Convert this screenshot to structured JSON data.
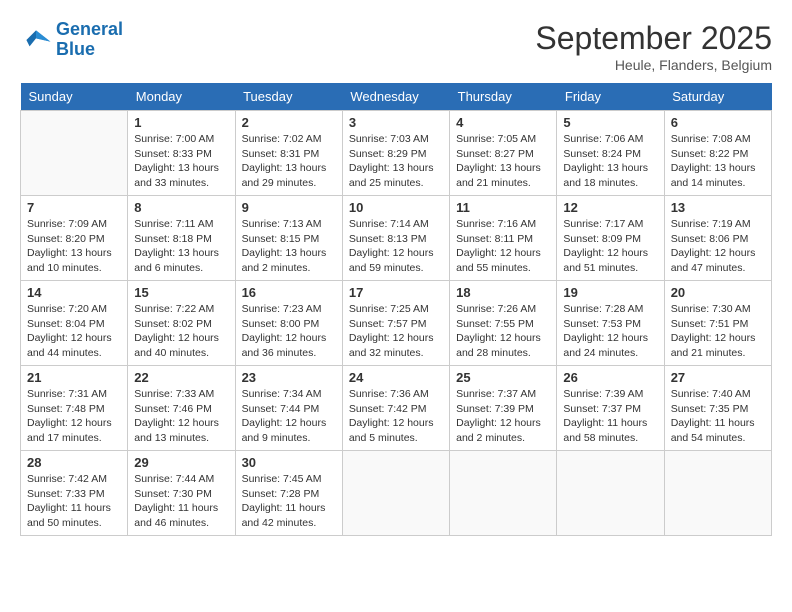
{
  "header": {
    "logo": {
      "line1": "General",
      "line2": "Blue"
    },
    "title": "September 2025",
    "subtitle": "Heule, Flanders, Belgium"
  },
  "weekdays": [
    "Sunday",
    "Monday",
    "Tuesday",
    "Wednesday",
    "Thursday",
    "Friday",
    "Saturday"
  ],
  "weeks": [
    [
      {
        "day": "",
        "info": ""
      },
      {
        "day": "1",
        "info": "Sunrise: 7:00 AM\nSunset: 8:33 PM\nDaylight: 13 hours\nand 33 minutes."
      },
      {
        "day": "2",
        "info": "Sunrise: 7:02 AM\nSunset: 8:31 PM\nDaylight: 13 hours\nand 29 minutes."
      },
      {
        "day": "3",
        "info": "Sunrise: 7:03 AM\nSunset: 8:29 PM\nDaylight: 13 hours\nand 25 minutes."
      },
      {
        "day": "4",
        "info": "Sunrise: 7:05 AM\nSunset: 8:27 PM\nDaylight: 13 hours\nand 21 minutes."
      },
      {
        "day": "5",
        "info": "Sunrise: 7:06 AM\nSunset: 8:24 PM\nDaylight: 13 hours\nand 18 minutes."
      },
      {
        "day": "6",
        "info": "Sunrise: 7:08 AM\nSunset: 8:22 PM\nDaylight: 13 hours\nand 14 minutes."
      }
    ],
    [
      {
        "day": "7",
        "info": "Sunrise: 7:09 AM\nSunset: 8:20 PM\nDaylight: 13 hours\nand 10 minutes."
      },
      {
        "day": "8",
        "info": "Sunrise: 7:11 AM\nSunset: 8:18 PM\nDaylight: 13 hours\nand 6 minutes."
      },
      {
        "day": "9",
        "info": "Sunrise: 7:13 AM\nSunset: 8:15 PM\nDaylight: 13 hours\nand 2 minutes."
      },
      {
        "day": "10",
        "info": "Sunrise: 7:14 AM\nSunset: 8:13 PM\nDaylight: 12 hours\nand 59 minutes."
      },
      {
        "day": "11",
        "info": "Sunrise: 7:16 AM\nSunset: 8:11 PM\nDaylight: 12 hours\nand 55 minutes."
      },
      {
        "day": "12",
        "info": "Sunrise: 7:17 AM\nSunset: 8:09 PM\nDaylight: 12 hours\nand 51 minutes."
      },
      {
        "day": "13",
        "info": "Sunrise: 7:19 AM\nSunset: 8:06 PM\nDaylight: 12 hours\nand 47 minutes."
      }
    ],
    [
      {
        "day": "14",
        "info": "Sunrise: 7:20 AM\nSunset: 8:04 PM\nDaylight: 12 hours\nand 44 minutes."
      },
      {
        "day": "15",
        "info": "Sunrise: 7:22 AM\nSunset: 8:02 PM\nDaylight: 12 hours\nand 40 minutes."
      },
      {
        "day": "16",
        "info": "Sunrise: 7:23 AM\nSunset: 8:00 PM\nDaylight: 12 hours\nand 36 minutes."
      },
      {
        "day": "17",
        "info": "Sunrise: 7:25 AM\nSunset: 7:57 PM\nDaylight: 12 hours\nand 32 minutes."
      },
      {
        "day": "18",
        "info": "Sunrise: 7:26 AM\nSunset: 7:55 PM\nDaylight: 12 hours\nand 28 minutes."
      },
      {
        "day": "19",
        "info": "Sunrise: 7:28 AM\nSunset: 7:53 PM\nDaylight: 12 hours\nand 24 minutes."
      },
      {
        "day": "20",
        "info": "Sunrise: 7:30 AM\nSunset: 7:51 PM\nDaylight: 12 hours\nand 21 minutes."
      }
    ],
    [
      {
        "day": "21",
        "info": "Sunrise: 7:31 AM\nSunset: 7:48 PM\nDaylight: 12 hours\nand 17 minutes."
      },
      {
        "day": "22",
        "info": "Sunrise: 7:33 AM\nSunset: 7:46 PM\nDaylight: 12 hours\nand 13 minutes."
      },
      {
        "day": "23",
        "info": "Sunrise: 7:34 AM\nSunset: 7:44 PM\nDaylight: 12 hours\nand 9 minutes."
      },
      {
        "day": "24",
        "info": "Sunrise: 7:36 AM\nSunset: 7:42 PM\nDaylight: 12 hours\nand 5 minutes."
      },
      {
        "day": "25",
        "info": "Sunrise: 7:37 AM\nSunset: 7:39 PM\nDaylight: 12 hours\nand 2 minutes."
      },
      {
        "day": "26",
        "info": "Sunrise: 7:39 AM\nSunset: 7:37 PM\nDaylight: 11 hours\nand 58 minutes."
      },
      {
        "day": "27",
        "info": "Sunrise: 7:40 AM\nSunset: 7:35 PM\nDaylight: 11 hours\nand 54 minutes."
      }
    ],
    [
      {
        "day": "28",
        "info": "Sunrise: 7:42 AM\nSunset: 7:33 PM\nDaylight: 11 hours\nand 50 minutes."
      },
      {
        "day": "29",
        "info": "Sunrise: 7:44 AM\nSunset: 7:30 PM\nDaylight: 11 hours\nand 46 minutes."
      },
      {
        "day": "30",
        "info": "Sunrise: 7:45 AM\nSunset: 7:28 PM\nDaylight: 11 hours\nand 42 minutes."
      },
      {
        "day": "",
        "info": ""
      },
      {
        "day": "",
        "info": ""
      },
      {
        "day": "",
        "info": ""
      },
      {
        "day": "",
        "info": ""
      }
    ]
  ]
}
